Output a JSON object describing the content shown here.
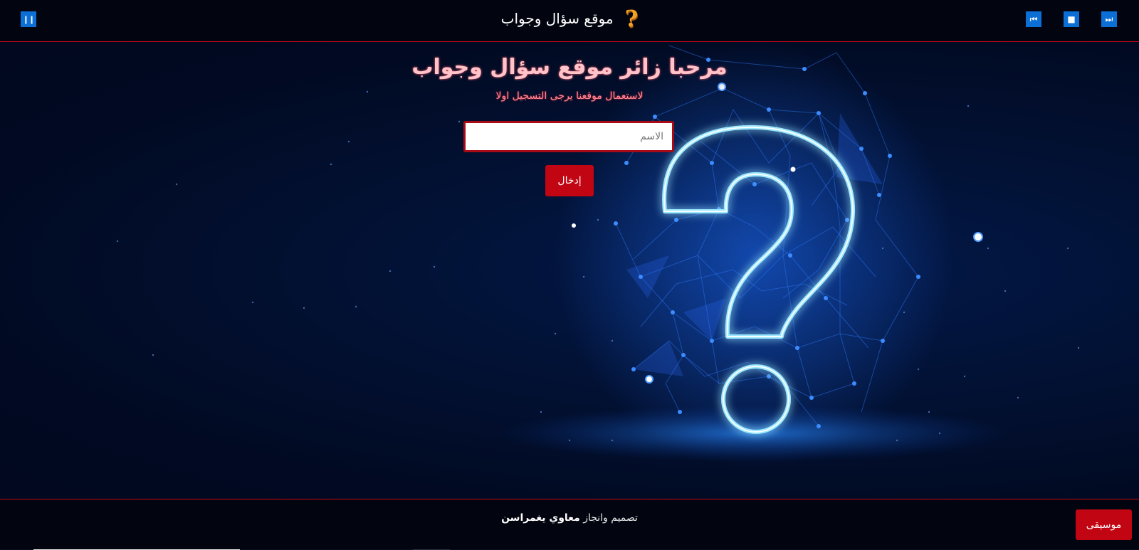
{
  "header": {
    "title": "موقع سؤال وجواب",
    "logo_icon": "question-mark-icon",
    "logo_glyph": "?",
    "pause_icon": "pause-icon",
    "pause_glyph": "❙❙",
    "prev_icon": "skip-back-icon",
    "prev_glyph": "⏮",
    "stop_icon": "stop-icon",
    "stop_glyph": "■",
    "next_icon": "skip-forward-icon",
    "next_glyph": "⏭"
  },
  "main": {
    "welcome": "مرحبا زائر موقع سؤال وجواب",
    "subtitle": "لاستعمال موقعنا يرجى التسجيل اولا",
    "name_input": {
      "placeholder": "الاسم",
      "value": ""
    },
    "enter_button": "إدخال"
  },
  "footer": {
    "credit_prefix": "تصميم وانجاز",
    "credit_name": "معاوي يغمراسن",
    "music_button": "موسيقى"
  },
  "colors": {
    "accent_red": "#c10512",
    "control_blue": "#0b6fd6",
    "background": "#01091f",
    "welcome_text": "#ffc3c9"
  }
}
